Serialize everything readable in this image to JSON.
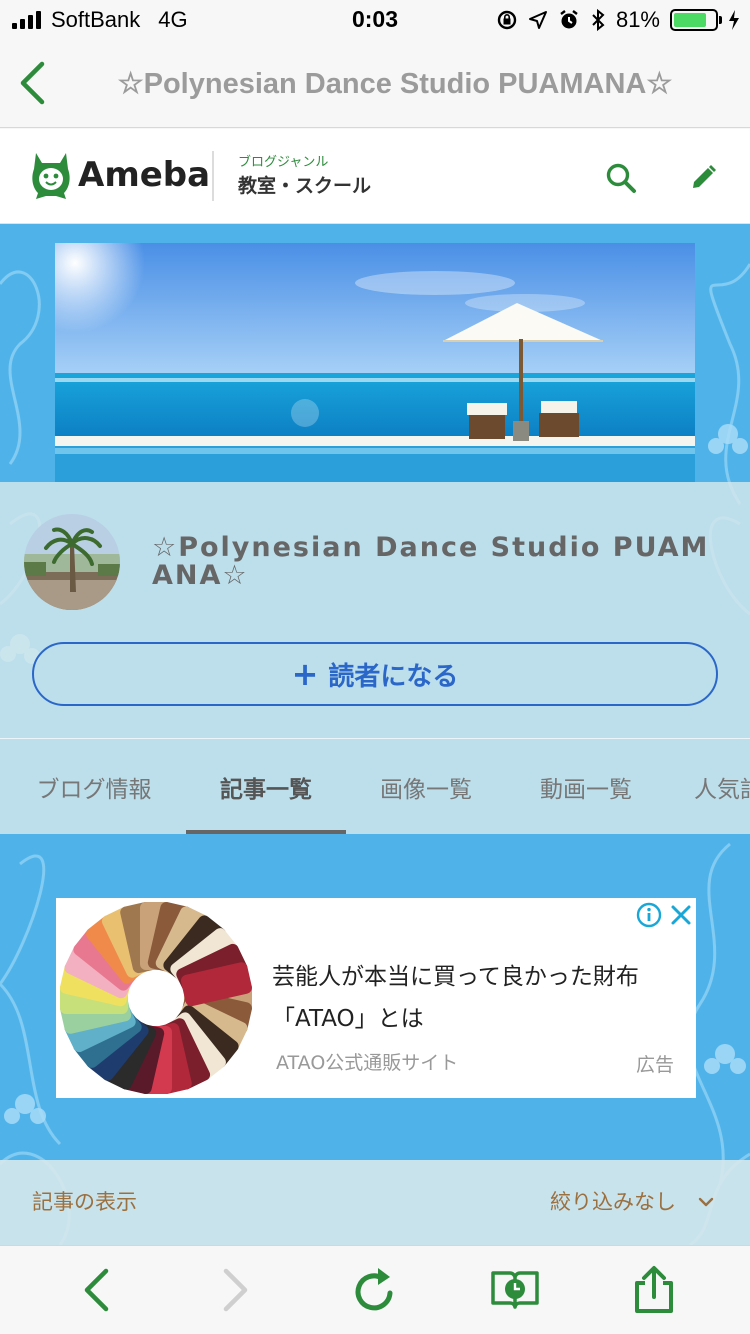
{
  "status_bar": {
    "carrier": "SoftBank",
    "network": "4G",
    "time": "0:03",
    "battery_percent": "81%",
    "battery_level": 0.81
  },
  "browser": {
    "page_title": "☆Polynesian Dance Studio PUAMANA☆"
  },
  "ameba_header": {
    "logo_text": "Ameba",
    "genre_label": "ブログジャンル",
    "genre_value": "教室・スクール"
  },
  "profile": {
    "blog_title": "☆Polynesian Dance Studio PUAMANA☆",
    "follow_label": "読者になる"
  },
  "tabs": [
    {
      "label": "ブログ情報"
    },
    {
      "label": "記事一覧"
    },
    {
      "label": "画像一覧"
    },
    {
      "label": "動画一覧"
    },
    {
      "label": "人気記"
    }
  ],
  "ad": {
    "headline": "芸能人が本当に買って良かった財布「ATAO」とは",
    "source": "ATAO公式通販サイト",
    "label": "広告"
  },
  "filter": {
    "label": "記事の表示",
    "value": "絞り込みなし"
  },
  "colors": {
    "ameba_green": "#2d8c3c",
    "follow_blue": "#2a67c9",
    "page_blue": "#4fb3ea",
    "filter_brown": "#9b7040"
  }
}
